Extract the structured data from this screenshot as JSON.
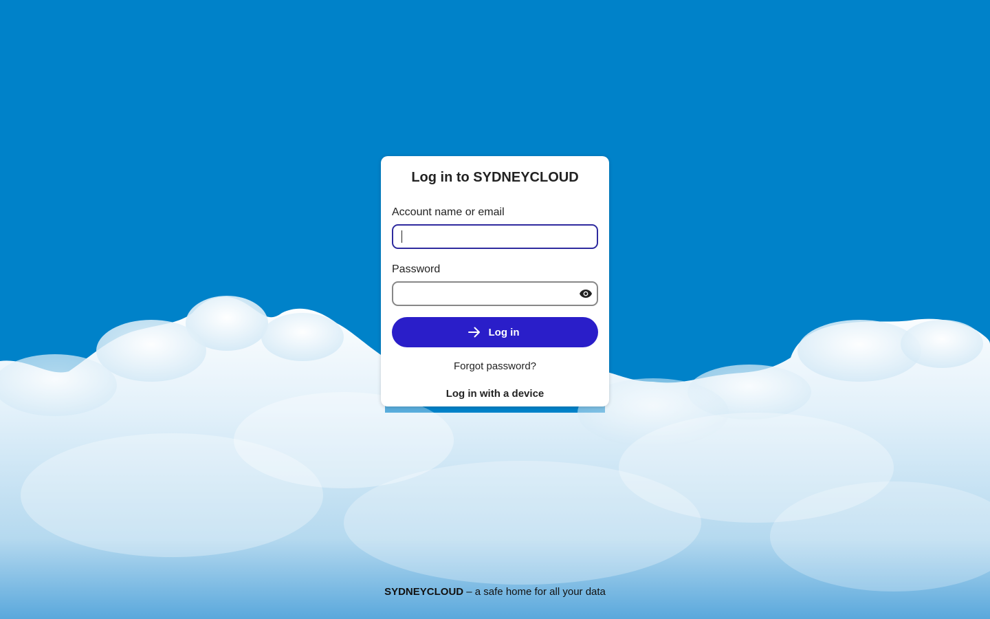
{
  "colors": {
    "sky": "#0082c9",
    "primary_button": "#2a1ec9",
    "focus_border": "#2e2a9e",
    "card_background": "#ffffff"
  },
  "login": {
    "title": "Log in to SYDNEYCLOUD",
    "account_label": "Account name or email",
    "account_value": "",
    "password_label": "Password",
    "password_value": "",
    "show_password_icon": "eye-icon",
    "login_button_icon": "arrow-right-icon",
    "login_button_label": "Log in",
    "forgot_password_link": "Forgot password?",
    "device_login_link": "Log in with a device"
  },
  "footer": {
    "brand": "SYDNEYCLOUD",
    "tagline": " – a safe home for all your data"
  }
}
